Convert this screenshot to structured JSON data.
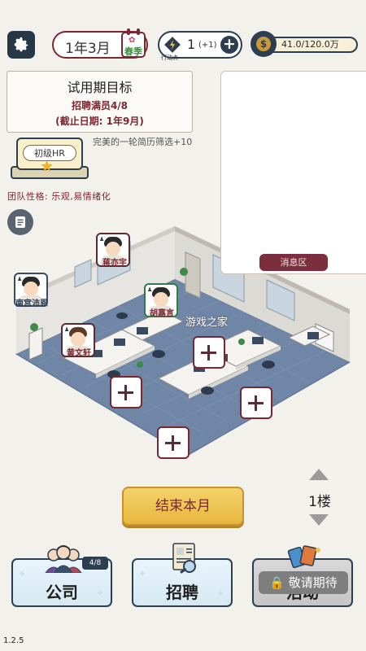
{
  "top_bar": {
    "date": "1年3月",
    "season": "春季",
    "action_points": {
      "value": "1",
      "delta": "(+1)",
      "label": "行动点"
    },
    "money": "41.0/120.0万"
  },
  "goal": {
    "title": "试用期目标",
    "requirement": "招聘满员4/8",
    "deadline": "(截止日期: 1年9月)"
  },
  "hr_badge": {
    "rank": "初级HR",
    "bonus": "完美的一轮简历筛选+10"
  },
  "team_trait": "团队性格: 乐观,易情绪化",
  "message_panel": {
    "tab": "消息区"
  },
  "office": {
    "workers": [
      {
        "name": "蒋亦宇"
      },
      {
        "name": "南宫沛恩"
      },
      {
        "name": "胡嘉言"
      },
      {
        "name": "黄文轩"
      }
    ],
    "watermark": "游戏之家"
  },
  "floor": {
    "label": "1楼"
  },
  "end_month_button": "结束本月",
  "menu": {
    "company": {
      "label": "公司",
      "badge": "4/8"
    },
    "recruit": {
      "label": "招聘"
    },
    "event": {
      "label": "活动",
      "locked_text": "敬请期待"
    }
  },
  "version": "1.2.5",
  "colors": {
    "accent": "#7b2732",
    "navy": "#2d3e50",
    "gold": "#e8b63f"
  }
}
